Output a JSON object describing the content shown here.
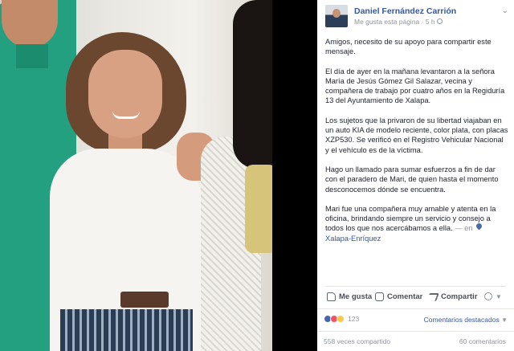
{
  "post": {
    "author": "Daniel Fernández Carrión",
    "meta_prefix": "Me gusta esta página",
    "meta_sep": " · ",
    "time": "5 h",
    "paragraphs": [
      "Amigos, necesito de su apoyo para compartir este mensaje.",
      "El día de ayer en la mañana levantaron a la señora María de Jesús Gómez Gil Salazar, vecina y compañera de trabajo por cuatro años en la Regiduría 13 del Ayuntamiento de Xalapa.",
      "Los sujetos que la privaron de su libertad viajaban en un auto KIA de modelo reciente, color plata, con placas XZP530. Se verificó en el Registro Vehicular Nacional y el vehículo es de la víctima.",
      "Hago un llamado para sumar esfuerzos a fin de dar con el paradero de Mari, de quien hasta el momento desconocemos dónde se encuentra."
    ],
    "last_paragraph": "Mari fue una compañera muy amable y atenta en la oficina, brindando siempre un servicio y consejo a todos los que nos acercábamos a ella.",
    "location_prefix": "— en",
    "location": "Xalapa-Enríquez"
  },
  "actions": {
    "like": "Me gusta",
    "comment": "Comentar",
    "share": "Compartir"
  },
  "stats": {
    "reactions_count": "123",
    "featured_label": "Comentarios destacados",
    "shares": "558 veces compartido",
    "comments": "60 comentarios"
  },
  "colors": {
    "link": "#365899",
    "text": "#1d2129",
    "muted": "#90949c"
  }
}
